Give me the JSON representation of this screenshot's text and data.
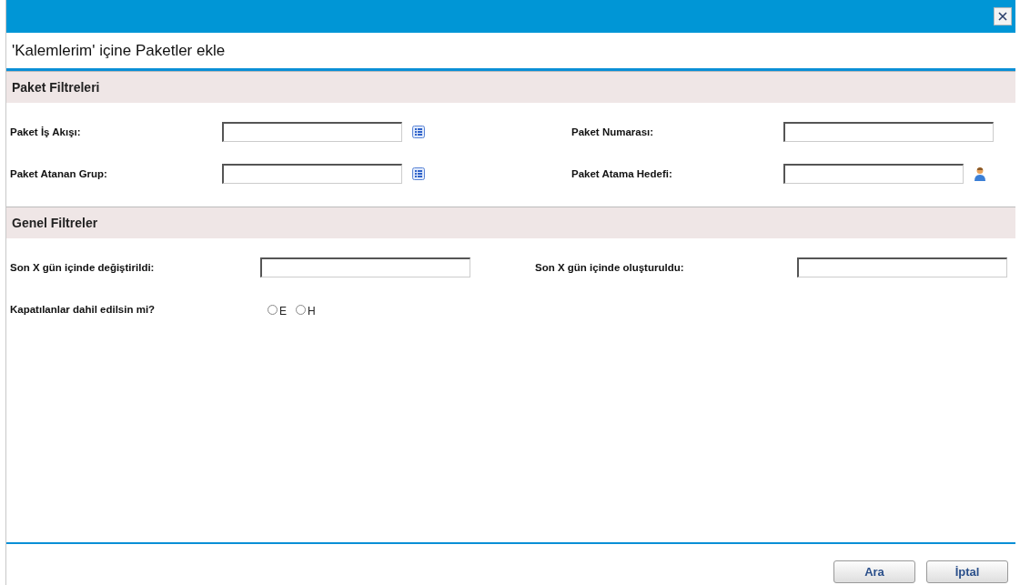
{
  "dialog": {
    "title": "'Kalemlerim' içine Paketler ekle"
  },
  "sections": [
    {
      "title": "Paket Filtreleri",
      "fields": [
        {
          "label": "Paket İş Akışı:",
          "kind": "list"
        },
        {
          "label": "Paket Numarası:",
          "kind": "plain"
        },
        {
          "label": "Paket Atanan Grup:",
          "kind": "list"
        },
        {
          "label": "Paket Atama Hedefi:",
          "kind": "person"
        }
      ]
    },
    {
      "title": "Genel Filtreler",
      "fields": [
        {
          "label": "Son X gün içinde değiştirildi:",
          "kind": "plain"
        },
        {
          "label": "Son X gün içinde oluşturuldu:",
          "kind": "plain"
        },
        {
          "label": "Kapatılanlar dahil edilsin mi?",
          "kind": "radio",
          "options": [
            {
              "label": "E",
              "selected": false
            },
            {
              "label": "H",
              "selected": false
            }
          ]
        }
      ]
    }
  ],
  "buttons": [
    "Ara",
    "İptal"
  ]
}
